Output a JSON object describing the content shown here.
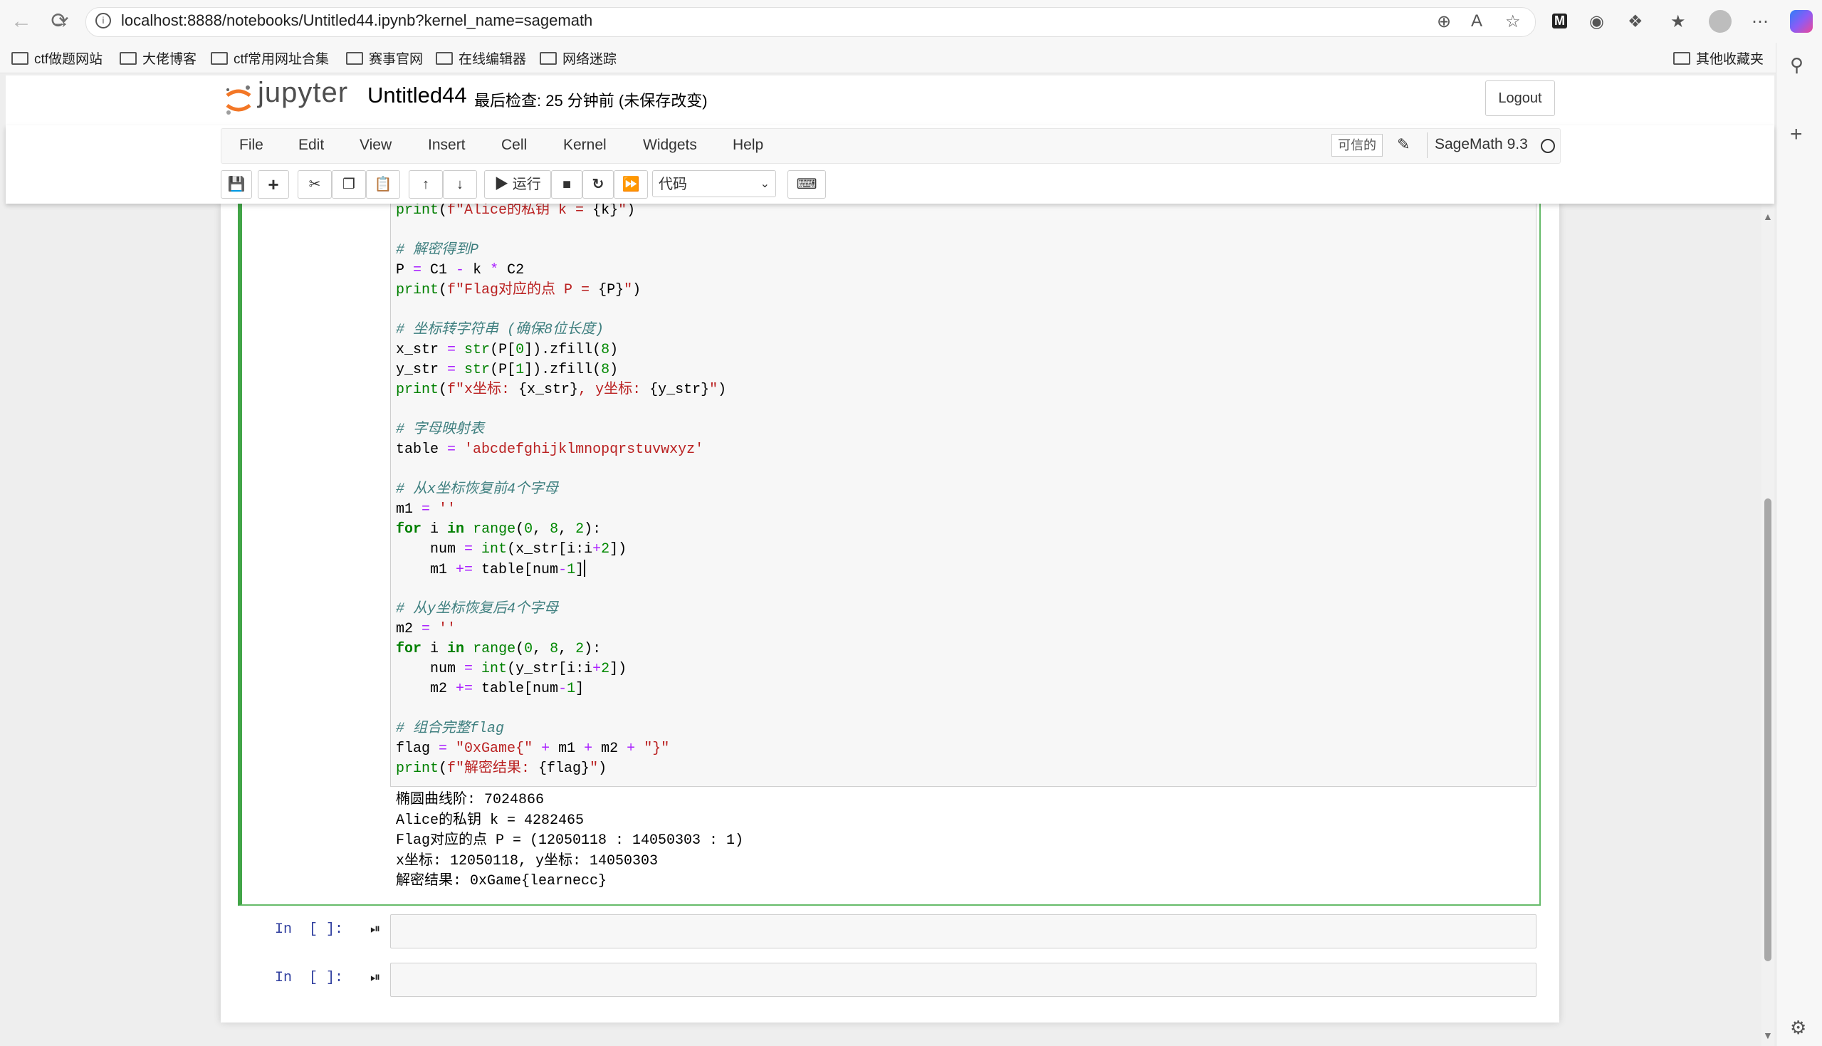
{
  "browser": {
    "url": "localhost:8888/notebooks/Untitled44.ipynb?kernel_name=sagemath",
    "bookmarks": [
      "ctf做题网站",
      "大佬博客",
      "ctf常用网址合集",
      "赛事官网",
      "在线编辑器",
      "网络迷踪"
    ],
    "other_bookmarks": "其他收藏夹"
  },
  "header": {
    "logo_text": "jupyter",
    "notebook_title": "Untitled44",
    "checkpoint": "最后检查: 25 分钟前  (未保存改变)",
    "logout_label": "Logout"
  },
  "menu": {
    "items": [
      "File",
      "Edit",
      "View",
      "Insert",
      "Cell",
      "Kernel",
      "Widgets",
      "Help"
    ],
    "trusted": "可信的",
    "kernel_name": "SageMath 9.3"
  },
  "toolbar": {
    "run_label": "运行",
    "cell_type": "代码"
  },
  "cell": {
    "code_lines": [
      "print(f\"Alice的私钥 k = {k}\")",
      "",
      "# 解密得到P",
      "P = C1 - k * C2",
      "print(f\"Flag对应的点 P = {P}\")",
      "",
      "# 坐标转字符串 (确保8位长度)",
      "x_str = str(P[0]).zfill(8)",
      "y_str = str(P[1]).zfill(8)",
      "print(f\"x坐标: {x_str}, y坐标: {y_str}\")",
      "",
      "# 字母映射表",
      "table = 'abcdefghijklmnopqrstuvwxyz'",
      "",
      "# 从x坐标恢复前4个字母",
      "m1 = ''",
      "for i in range(0, 8, 2):",
      "    num = int(x_str[i:i+2])",
      "    m1 += table[num-1]",
      "",
      "# 从y坐标恢复后4个字母",
      "m2 = ''",
      "for i in range(0, 8, 2):",
      "    num = int(y_str[i:i+2])",
      "    m2 += table[num-1]",
      "",
      "# 组合完整flag",
      "flag = \"0xGame{\" + m1 + m2 + \"}\"",
      "print(f\"解密结果: {flag}\")"
    ],
    "output_lines": [
      "椭圆曲线阶: 7024866",
      "Alice的私钥 k = 4282465",
      "Flag对应的点 P = (12050118 : 14050303 : 1)",
      "x坐标: 12050118, y坐标: 14050303",
      "解密结果: 0xGame{learnecc}"
    ]
  },
  "empty_cells": [
    {
      "prompt": "In  [ ]:"
    },
    {
      "prompt": "In  [ ]:"
    }
  ]
}
